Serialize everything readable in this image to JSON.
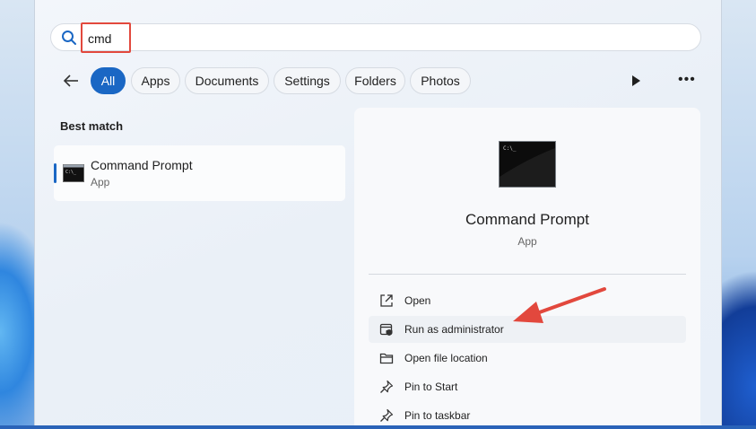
{
  "search": {
    "query": "cmd"
  },
  "filters": [
    {
      "label": "All",
      "active": true
    },
    {
      "label": "Apps",
      "active": false
    },
    {
      "label": "Documents",
      "active": false
    },
    {
      "label": "Settings",
      "active": false
    },
    {
      "label": "Folders",
      "active": false
    },
    {
      "label": "Photos",
      "active": false
    }
  ],
  "best_match": {
    "heading": "Best match",
    "title": "Command Prompt",
    "subtitle": "App"
  },
  "detail": {
    "title": "Command Prompt",
    "subtitle": "App",
    "actions": [
      {
        "label": "Open",
        "icon": "open-external-icon"
      },
      {
        "label": "Run as administrator",
        "icon": "shield-admin-icon"
      },
      {
        "label": "Open file location",
        "icon": "folder-icon"
      },
      {
        "label": "Pin to Start",
        "icon": "pin-icon"
      },
      {
        "label": "Pin to taskbar",
        "icon": "pin-icon"
      }
    ]
  },
  "colors": {
    "accent": "#1a67c4",
    "annotation": "#e2483d"
  }
}
